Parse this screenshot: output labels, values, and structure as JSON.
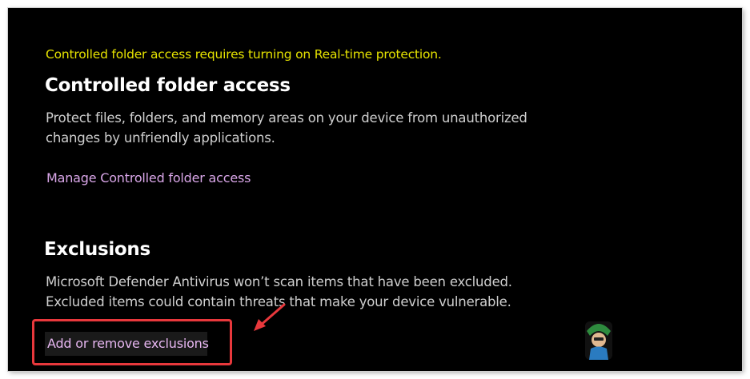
{
  "cfa": {
    "warning": "Controlled folder access requires turning on Real-time protection.",
    "title": "Controlled folder access",
    "description": "Protect files, folders, and memory areas on your device from unauthorized changes by unfriendly applications.",
    "manage_link": "Manage Controlled folder access"
  },
  "exclusions": {
    "title": "Exclusions",
    "description": "Microsoft Defender Antivirus won’t scan items that have been excluded. Excluded items could contain threats that make your device vulnerable.",
    "add_remove_link": "Add or remove exclusions"
  },
  "colors": {
    "background": "#000000",
    "warning": "#e6e300",
    "link": "#d9a6e8",
    "highlight": "#e8383c"
  },
  "icons": {
    "annotation_arrow": "red-arrow-icon",
    "watermark": "appuals-logo"
  }
}
